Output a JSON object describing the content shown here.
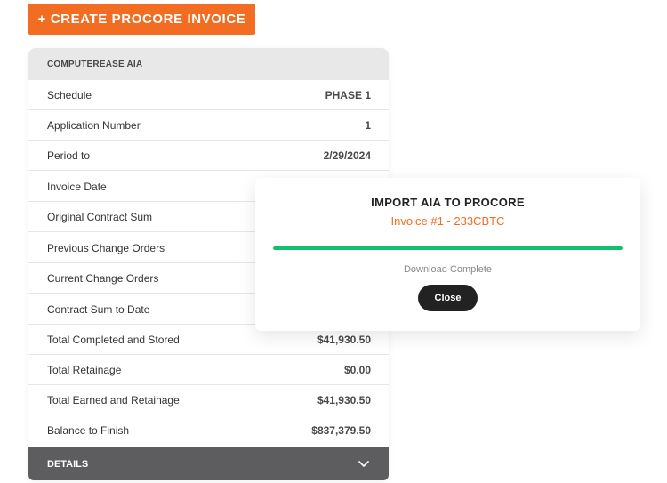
{
  "toolbar": {
    "create_button_label": "+ CREATE PROCORE INVOICE"
  },
  "panel": {
    "header": "COMPUTEREASE AIA",
    "rows": [
      {
        "label": "Schedule",
        "value": "PHASE 1"
      },
      {
        "label": "Application Number",
        "value": "1"
      },
      {
        "label": "Period to",
        "value": "2/29/2024"
      },
      {
        "label": "Invoice Date",
        "value": ""
      },
      {
        "label": "Original Contract Sum",
        "value": ""
      },
      {
        "label": "Previous Change Orders",
        "value": ""
      },
      {
        "label": "Current Change Orders",
        "value": ""
      },
      {
        "label": "Contract Sum to Date",
        "value": ""
      },
      {
        "label": "Total Completed and Stored",
        "value": "$41,930.50"
      },
      {
        "label": "Total Retainage",
        "value": "$0.00"
      },
      {
        "label": "Total Earned and Retainage",
        "value": "$41,930.50"
      },
      {
        "label": "Balance to Finish",
        "value": "$837,379.50"
      }
    ],
    "details_label": "DETAILS",
    "details_icon": "chevron-down-icon"
  },
  "modal": {
    "title": "IMPORT AIA TO PROCORE",
    "subtitle": "Invoice #1 - 233CBTC",
    "progress_percent": 100,
    "status": "Download Complete",
    "close_label": "Close"
  },
  "colors": {
    "accent": "#f26d21",
    "progress": "#10c270",
    "details_bar": "#5d5d60",
    "close_button": "#222222"
  }
}
